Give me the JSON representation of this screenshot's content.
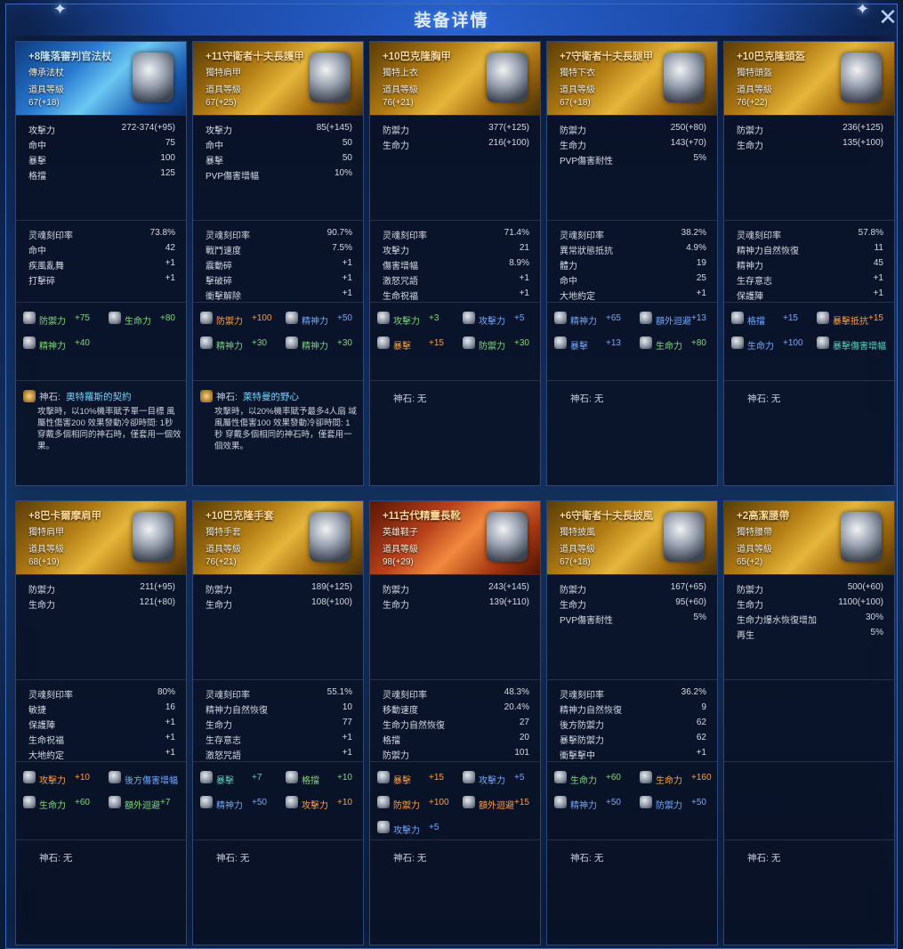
{
  "window": {
    "title": "装备详情",
    "close_icon": "✕"
  },
  "cards": [
    {
      "rarity": "blue",
      "name": "+8隆落審判官法杖",
      "type": "傳承法杖",
      "level_label": "道具等級",
      "level": "67(+18)",
      "base": [
        [
          "攻擊力",
          "272-374(+95)"
        ],
        [
          "命中",
          "75"
        ],
        [
          "暴擊",
          "100"
        ],
        [
          "格擋",
          "125"
        ]
      ],
      "soul": [
        [
          "灵魂刻印率",
          "73.8%"
        ],
        [
          "命中",
          "42"
        ],
        [
          "疾風亂舞",
          "+1"
        ],
        [
          "打擊碎",
          "+1"
        ]
      ],
      "bonus": [
        {
          "n": "防禦力",
          "v": "+75",
          "c": "c-green"
        },
        {
          "n": "生命力",
          "v": "+80",
          "c": "c-green"
        },
        {
          "n": "精神力",
          "v": "+40",
          "c": "c-green"
        }
      ],
      "god_label": "神石:",
      "god_name": "奧特羅斯的契約",
      "god_desc": "攻擊時，以10%機率賦予單一目標 風屬性傷害200 效果發動冷卻時間: 1秒 穿戴多個相同的神石時，僅套用一個效果。"
    },
    {
      "rarity": "gold",
      "name": "+11守衛者十夫長護甲",
      "type": "獨特肩甲",
      "level_label": "道具等級",
      "level": "67(+25)",
      "base": [
        [
          "攻擊力",
          "85(+145)"
        ],
        [
          "命中",
          "50"
        ],
        [
          "暴擊",
          "50"
        ],
        [
          "PVP傷害增幅",
          "10%"
        ]
      ],
      "soul": [
        [
          "灵魂刻印率",
          "90.7%"
        ],
        [
          "戰鬥速度",
          "7.5%"
        ],
        [
          "震動碎",
          "+1"
        ],
        [
          "擊破碎",
          "+1"
        ],
        [
          "衝擊解除",
          "+1"
        ]
      ],
      "bonus": [
        {
          "n": "防禦力",
          "v": "+100",
          "c": "c-orange"
        },
        {
          "n": "精神力",
          "v": "+50",
          "c": "c-blue"
        },
        {
          "n": "精神力",
          "v": "+30",
          "c": "c-green"
        },
        {
          "n": "精神力",
          "v": "+30",
          "c": "c-green"
        }
      ],
      "god_label": "神石:",
      "god_name": "萊特曼的野心",
      "god_desc": "攻擊時，以20%機率賦予最多4人扇 域風屬性傷害100 效果發動冷卻時間: 1秒 穿戴多個相同的神石時，僅套用一 個效果。"
    },
    {
      "rarity": "gold",
      "name": "+10巴克隆胸甲",
      "type": "獨特上衣",
      "level_label": "道具等級",
      "level": "76(+21)",
      "base": [
        [
          "防禦力",
          "377(+125)"
        ],
        [
          "生命力",
          "216(+100)"
        ]
      ],
      "soul": [
        [
          "灵魂刻印率",
          "71.4%"
        ],
        [
          "攻擊力",
          "21"
        ],
        [
          "傷害增幅",
          "8.9%"
        ],
        [
          "激怒咒語",
          "+1"
        ],
        [
          "生命祝福",
          "+1"
        ]
      ],
      "bonus": [
        {
          "n": "攻擊力",
          "v": "+3",
          "c": "c-green"
        },
        {
          "n": "攻擊力",
          "v": "+5",
          "c": "c-blue"
        },
        {
          "n": "暴擊",
          "v": "+15",
          "c": "c-orange"
        },
        {
          "n": "防禦力",
          "v": "+30",
          "c": "c-green"
        }
      ],
      "god_label": "神石: 无",
      "god_name": "",
      "god_desc": ""
    },
    {
      "rarity": "gold",
      "name": "+7守衛者十夫長腿甲",
      "type": "獨特下衣",
      "level_label": "道具等級",
      "level": "67(+18)",
      "base": [
        [
          "防禦力",
          "250(+80)"
        ],
        [
          "生命力",
          "143(+70)"
        ],
        [
          "PVP傷害耐性",
          "5%"
        ]
      ],
      "soul": [
        [
          "灵魂刻印率",
          "38.2%"
        ],
        [
          "異常狀態抵抗",
          "4.9%"
        ],
        [
          "體力",
          "19"
        ],
        [
          "命中",
          "25"
        ],
        [
          "大地約定",
          "+1"
        ]
      ],
      "bonus": [
        {
          "n": "精神力",
          "v": "+65",
          "c": "c-blue"
        },
        {
          "n": "額外迴避",
          "v": "+13",
          "c": "c-blue"
        },
        {
          "n": "暴擊",
          "v": "+13",
          "c": "c-blue"
        },
        {
          "n": "生命力",
          "v": "+80",
          "c": "c-green"
        }
      ],
      "god_label": "神石: 无",
      "god_name": "",
      "god_desc": ""
    },
    {
      "rarity": "gold",
      "name": "+10巴克隆頭盔",
      "type": "獨特頭盔",
      "level_label": "道具等級",
      "level": "76(+22)",
      "base": [
        [
          "防禦力",
          "236(+125)"
        ],
        [
          "生命力",
          "135(+100)"
        ]
      ],
      "soul": [
        [
          "灵魂刻印率",
          "57.8%"
        ],
        [
          "精神力自然恢復",
          "11"
        ],
        [
          "精神力",
          "45"
        ],
        [
          "生存意志",
          "+1"
        ],
        [
          "保護陣",
          "+1"
        ]
      ],
      "bonus": [
        {
          "n": "格擋",
          "v": "+15",
          "c": "c-blue"
        },
        {
          "n": "暴擊抵抗",
          "v": "+15",
          "c": "c-orange"
        },
        {
          "n": "生命力",
          "v": "+100",
          "c": "c-blue"
        },
        {
          "n": "暴擊傷害增幅",
          "v": "",
          "c": "c-teal"
        }
      ],
      "god_label": "神石: 无",
      "god_name": "",
      "god_desc": ""
    },
    {
      "rarity": "gold",
      "name": "+8巴卡爾摩肩甲",
      "type": "獨特肩甲",
      "level_label": "道具等級",
      "level": "68(+19)",
      "base": [
        [
          "防禦力",
          "211(+95)"
        ],
        [
          "生命力",
          "121(+80)"
        ]
      ],
      "soul": [
        [
          "灵魂刻印率",
          "80%"
        ],
        [
          "敏捷",
          "16"
        ],
        [
          "保護陣",
          "+1"
        ],
        [
          "生命祝福",
          "+1"
        ],
        [
          "大地約定",
          "+1"
        ]
      ],
      "bonus": [
        {
          "n": "攻擊力",
          "v": "+10",
          "c": "c-orange"
        },
        {
          "n": "後方傷害增幅",
          "v": "",
          "c": "c-blue"
        },
        {
          "n": "生命力",
          "v": "+60",
          "c": "c-green"
        },
        {
          "n": "額外迴避",
          "v": "+7",
          "c": "c-green"
        }
      ],
      "god_label": "神石: 无",
      "god_name": "",
      "god_desc": ""
    },
    {
      "rarity": "gold",
      "name": "+10巴克隆手套",
      "type": "獨特手套",
      "level_label": "道具等級",
      "level": "76(+21)",
      "base": [
        [
          "防禦力",
          "189(+125)"
        ],
        [
          "生命力",
          "108(+100)"
        ]
      ],
      "soul": [
        [
          "灵魂刻印率",
          "55.1%"
        ],
        [
          "精神力自然恢復",
          "10"
        ],
        [
          "生命力",
          "77"
        ],
        [
          "生存意志",
          "+1"
        ],
        [
          "激怒咒語",
          "+1"
        ]
      ],
      "bonus": [
        {
          "n": "暴擊",
          "v": "+7",
          "c": "c-teal"
        },
        {
          "n": "格擋",
          "v": "+10",
          "c": "c-green"
        },
        {
          "n": "精神力",
          "v": "+50",
          "c": "c-blue"
        },
        {
          "n": "攻擊力",
          "v": "+10",
          "c": "c-orange"
        }
      ],
      "god_label": "神石: 无",
      "god_name": "",
      "god_desc": ""
    },
    {
      "rarity": "red",
      "name": "+11古代精靈長靴",
      "type": "英雄鞋子",
      "level_label": "道具等級",
      "level": "98(+29)",
      "base": [
        [
          "防禦力",
          "243(+145)"
        ],
        [
          "生命力",
          "139(+110)"
        ]
      ],
      "soul": [
        [
          "灵魂刻印率",
          "48.3%"
        ],
        [
          "移動速度",
          "20.4%"
        ],
        [
          "生命力自然恢復",
          "27"
        ],
        [
          "格擋",
          "20"
        ],
        [
          "防禦力",
          "101"
        ]
      ],
      "bonus": [
        {
          "n": "暴擊",
          "v": "+15",
          "c": "c-orange"
        },
        {
          "n": "攻擊力",
          "v": "+5",
          "c": "c-blue"
        },
        {
          "n": "防禦力",
          "v": "+100",
          "c": "c-orange"
        },
        {
          "n": "額外迴避",
          "v": "+15",
          "c": "c-orange"
        },
        {
          "n": "攻擊力",
          "v": "+5",
          "c": "c-blue"
        }
      ],
      "god_label": "神石: 无",
      "god_name": "",
      "god_desc": ""
    },
    {
      "rarity": "gold",
      "name": "+6守衛者十夫長披風",
      "type": "獨特披風",
      "level_label": "道具等級",
      "level": "67(+18)",
      "base": [
        [
          "防禦力",
          "167(+65)"
        ],
        [
          "生命力",
          "95(+60)"
        ],
        [
          "PVP傷害耐性",
          "5%"
        ]
      ],
      "soul": [
        [
          "灵魂刻印率",
          "36.2%"
        ],
        [
          "精神力自然恢復",
          "9"
        ],
        [
          "後方防禦力",
          "62"
        ],
        [
          "暴擊防禦力",
          "62"
        ],
        [
          "衝擊擊中",
          "+1"
        ]
      ],
      "bonus": [
        {
          "n": "生命力",
          "v": "+60",
          "c": "c-green"
        },
        {
          "n": "生命力",
          "v": "+160",
          "c": "c-orange"
        },
        {
          "n": "精神力",
          "v": "+50",
          "c": "c-blue"
        },
        {
          "n": "防禦力",
          "v": "+50",
          "c": "c-blue"
        }
      ],
      "god_label": "神石: 无",
      "god_name": "",
      "god_desc": ""
    },
    {
      "rarity": "gold",
      "name": "+2高潔腰帶",
      "type": "獨特腰帶",
      "level_label": "道具等級",
      "level": "65(+2)",
      "base": [
        [
          "防禦力",
          "500(+60)"
        ],
        [
          "生命力",
          "1100(+100)"
        ],
        [
          "生命力爆水恢復增加",
          "30%"
        ],
        [
          "再生",
          "5%"
        ]
      ],
      "soul": [],
      "bonus": [],
      "god_label": "神石: 无",
      "god_name": "",
      "god_desc": ""
    }
  ]
}
